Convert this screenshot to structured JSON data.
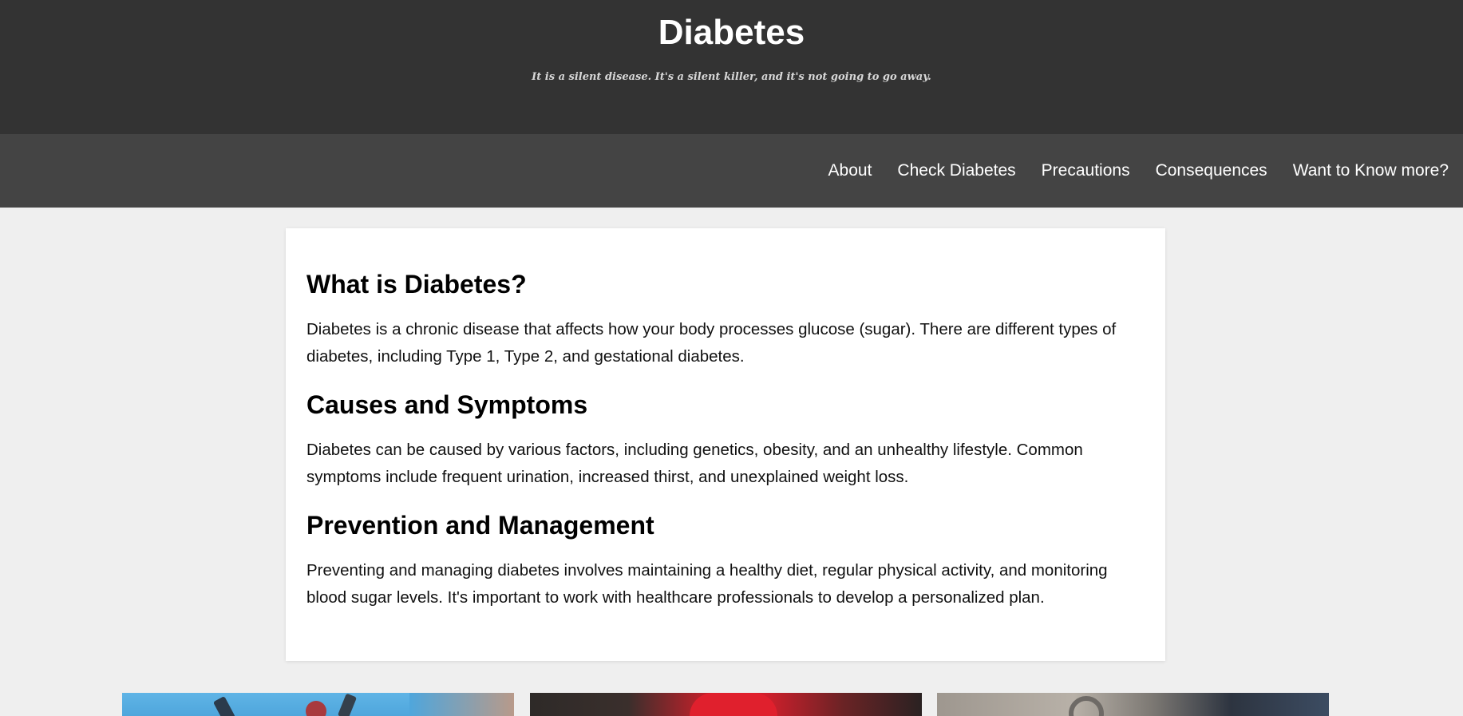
{
  "header": {
    "title": "Diabetes",
    "tagline": "It is a silent disease. It's a silent killer, and it's not going to go away."
  },
  "nav": {
    "items": [
      "About",
      "Check Diabetes",
      "Precautions",
      "Consequences",
      "Want to Know more?"
    ]
  },
  "sections": [
    {
      "heading": "What is Diabetes?",
      "body": "Diabetes is a chronic disease that affects how your body processes glucose (sugar). There are different types of diabetes, including Type 1, Type 2, and gestational diabetes."
    },
    {
      "heading": "Causes and Symptoms",
      "body": "Diabetes can be caused by various factors, including genetics, obesity, and an unhealthy lifestyle. Common symptoms include frequent urination, increased thirst, and unexplained weight loss."
    },
    {
      "heading": "Prevention and Management",
      "body": "Preventing and managing diabetes involves maintaining a healthy diet, regular physical activity, and monitoring blood sugar levels. It's important to work with healthcare professionals to develop a personalized plan."
    }
  ],
  "colors": {
    "header_bg": "#333333",
    "nav_bg": "#444444",
    "page_bg": "#efefef",
    "card_bg": "#ffffff"
  }
}
